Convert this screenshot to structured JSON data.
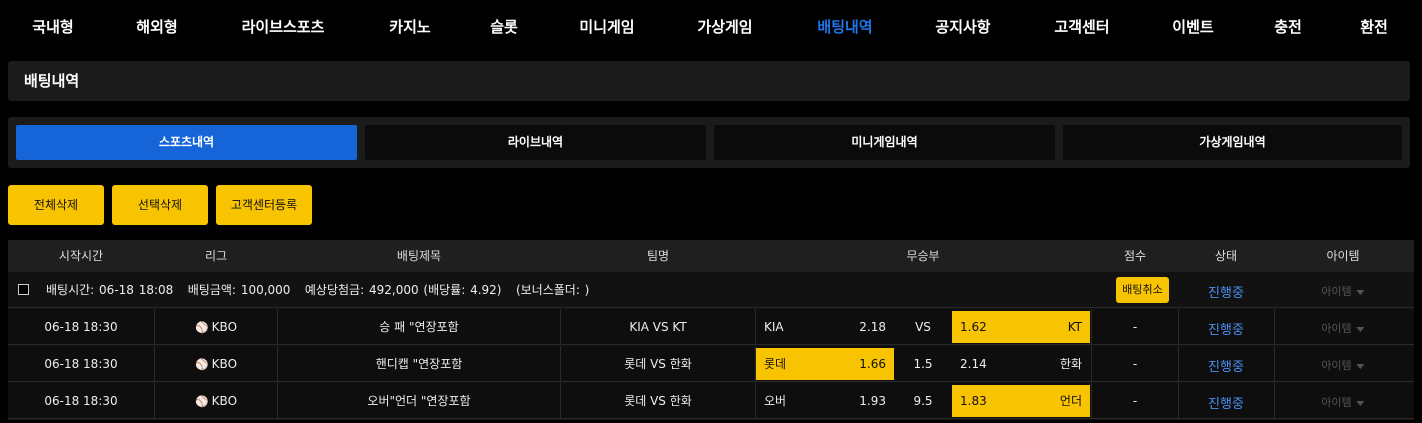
{
  "nav": {
    "items": [
      "국내형",
      "해외형",
      "라이브스포츠",
      "카지노",
      "슬롯",
      "미니게임",
      "가상게임",
      "배팅내역",
      "공지사항",
      "고객센터",
      "이벤트",
      "충전",
      "환전"
    ],
    "active": "배팅내역"
  },
  "page_title": "배팅내역",
  "tabs": [
    "스포츠내역",
    "라이브내역",
    "미니게임내역",
    "가상게임내역"
  ],
  "actions": {
    "delete_all": "전체삭제",
    "delete_selected": "선택삭제",
    "register_support": "고객센터등록"
  },
  "table": {
    "headers": [
      "시작시간",
      "리그",
      "배팅제목",
      "팀명",
      "무승부",
      "점수",
      "상태",
      "아이템"
    ],
    "summary": {
      "bet_time_label": "배팅시간:",
      "bet_time": "06-18 18:08",
      "bet_amount_label": "배팅금액:",
      "bet_amount": "100,000",
      "expected_label": "예상당첨금:",
      "expected": "492,000",
      "rate": "(배당률: 4.92)",
      "bonus": "(보너스폴더: )",
      "cancel_label": "배팅취소",
      "status": "진행중",
      "item": "아이템"
    },
    "rows": [
      {
        "time": "06-18 18:30",
        "league": "KBO",
        "title": "승 패 \"연장포함",
        "teams": "KIA VS KT",
        "home": "KIA",
        "home_odds": "2.18",
        "middle": "VS",
        "away_odds": "1.62",
        "away": "KT",
        "selected": "away",
        "score": "-",
        "status": "진행중",
        "item": "아이템"
      },
      {
        "time": "06-18 18:30",
        "league": "KBO",
        "title": "핸디캡 \"연장포함",
        "teams": "롯데 VS 한화",
        "home": "롯데",
        "home_odds": "1.66",
        "middle": "1.5",
        "away_odds": "2.14",
        "away": "한화",
        "selected": "home",
        "score": "-",
        "status": "진행중",
        "item": "아이템"
      },
      {
        "time": "06-18 18:30",
        "league": "KBO",
        "title": "오버\"언더 \"연장포함",
        "teams": "롯데 VS 한화",
        "home": "오버",
        "home_odds": "1.93",
        "middle": "9.5",
        "away_odds": "1.83",
        "away": "언더",
        "selected": "away",
        "score": "-",
        "status": "진행중",
        "item": "아이템"
      }
    ]
  },
  "colors": {
    "accent_blue": "#1565d8",
    "nav_active": "#1e74e8",
    "button_yellow": "#f8c300",
    "status_blue": "#4a8ff0"
  }
}
